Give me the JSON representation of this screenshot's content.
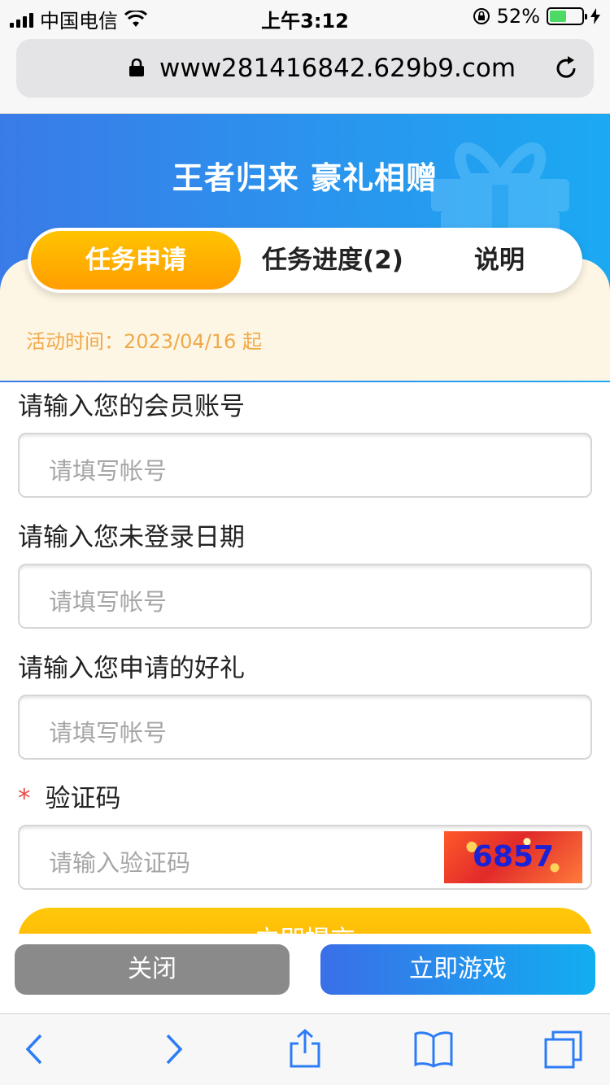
{
  "status_bar": {
    "carrier": "中国电信",
    "time": "上午3:12",
    "battery_percent": "52%",
    "battery_level": 0.52
  },
  "browser": {
    "url": "www281416842.629b9.com"
  },
  "banner": {
    "title": "王者归来 豪礼相赠"
  },
  "tabs": [
    {
      "label": "任务申请",
      "active": true
    },
    {
      "label": "任务进度(2)",
      "active": false
    },
    {
      "label": "说明",
      "active": false
    }
  ],
  "activity_time": "活动时间：2023/04/16 起",
  "form": {
    "account": {
      "label": "请输入您的会员账号",
      "placeholder": "请填写帐号"
    },
    "date": {
      "label": "请输入您未登录日期",
      "placeholder": "请填写帐号"
    },
    "gift": {
      "label": "请输入您申请的好礼",
      "placeholder": "请填写帐号"
    },
    "captcha": {
      "required_mark": "*",
      "label": "验证码",
      "placeholder": "请输入验证码",
      "code": "6857"
    },
    "submit_label": "立即提交"
  },
  "bottom_buttons": {
    "close": "关闭",
    "play": "立即游戏"
  },
  "colors": {
    "banner_blue": "#2a95ee",
    "tab_active": "#ff9d00",
    "activity_text": "#f0a94a",
    "required": "#e94949",
    "close_button": "#8a8a8a",
    "play_button": "#3a6fe8"
  }
}
